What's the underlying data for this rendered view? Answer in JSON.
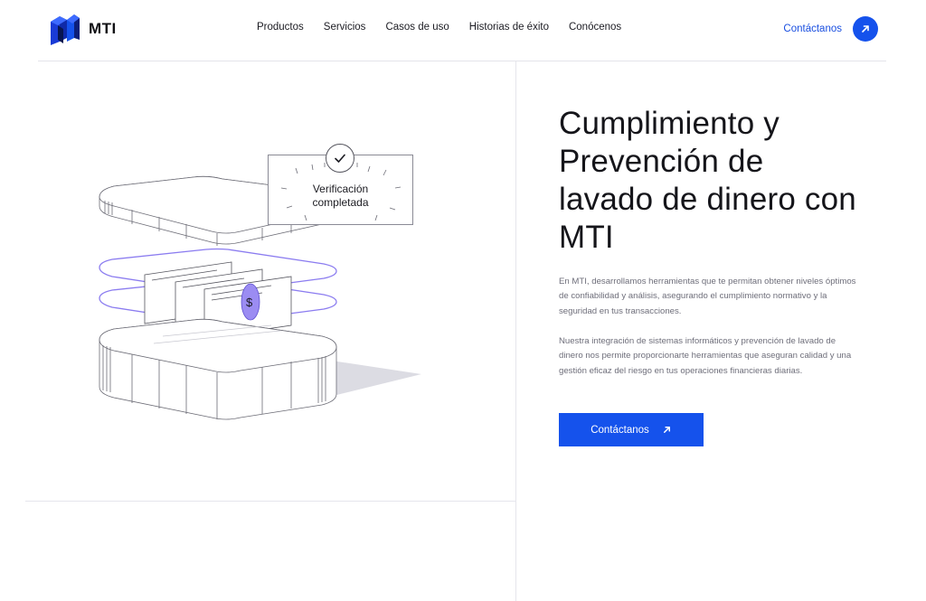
{
  "brand": {
    "name": "MTI",
    "accent": "#1552ec"
  },
  "nav": {
    "items": [
      {
        "label": "Productos"
      },
      {
        "label": "Servicios"
      },
      {
        "label": "Casos de uso"
      },
      {
        "label": "Historias de éxito"
      },
      {
        "label": "Conócenos"
      }
    ]
  },
  "header": {
    "cta_label": "Contáctanos",
    "cta_icon": "arrow-up-right-icon"
  },
  "illustration": {
    "badge_line1": "Verificación",
    "badge_line2": "completada",
    "badge_icon": "check-icon",
    "coin_symbol": "$"
  },
  "hero": {
    "title": "Cumplimiento y Prevención de lavado de dinero con MTI",
    "paragraph_1": "En MTI, desarrollamos herramientas que te permitan obtener niveles óptimos de confiabilidad y análisis, asegurando el cumplimiento normativo y la seguridad en tus transacciones.",
    "paragraph_2": "Nuestra integración de sistemas informáticos y prevención de lavado de dinero nos permite proporcionarte herramientas que aseguran calidad y una gestión eficaz del riesgo en tus operaciones financieras diarias.",
    "cta_label": "Contáctanos",
    "cta_icon": "arrow-up-right-icon"
  }
}
